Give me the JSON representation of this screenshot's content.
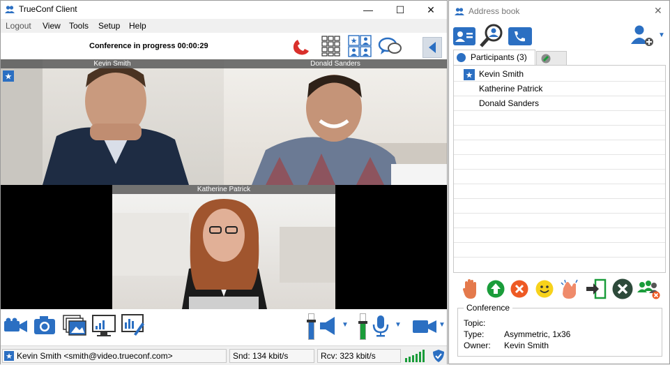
{
  "window": {
    "title": "TrueConf Client",
    "minimize": "—",
    "maximize": "☐",
    "close": "✕"
  },
  "menu": [
    "Logout",
    "View",
    "Tools",
    "Setup",
    "Help"
  ],
  "toolbar": {
    "status": "Conference in progress 00:00:29",
    "icons": [
      "hangup-icon",
      "dialpad-icon",
      "layout-icon",
      "chat-icon",
      "collapse-panel-icon"
    ]
  },
  "video": {
    "tiles": [
      {
        "name": "Kevin Smith",
        "owner": true
      },
      {
        "name": "Donald Sanders"
      },
      {
        "name": "Katherine Patrick"
      }
    ]
  },
  "bottom_icons": [
    "camera-toggle-icon",
    "snapshot-icon",
    "slideshow-icon",
    "screen-share-icon",
    "whiteboard-icon",
    "speaker-icon",
    "microphone-icon",
    "video-camera-icon"
  ],
  "statusbar": {
    "user": "Kevin Smith <smith@video.trueconf.com>",
    "send": "Snd: 134 kbit/s",
    "receive": "Rcv: 323 kbit/s"
  },
  "address_book": {
    "title": "Address book",
    "close": "✕",
    "tab_participants": "Participants (3)",
    "participants": [
      {
        "name": "Kevin Smith",
        "owner": true
      },
      {
        "name": "Katherine Patrick"
      },
      {
        "name": "Donald Sanders"
      }
    ],
    "conference": {
      "legend": "Conference",
      "topic_label": "Topic:",
      "topic": "",
      "type_label": "Type:",
      "type": "Asymmetric, 1x36",
      "owner_label": "Owner:",
      "owner": "Kevin Smith"
    }
  },
  "colors": {
    "accent": "#2b6fc2",
    "hangup": "#d9302c",
    "green": "#1a9c3a"
  }
}
